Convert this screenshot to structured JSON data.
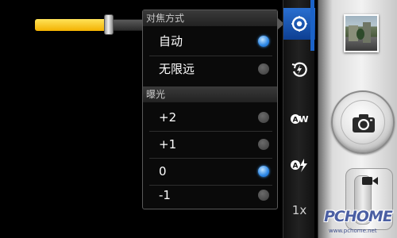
{
  "zoom_slider": {
    "value": 0.68
  },
  "settings_popup": {
    "focus_header": "对焦方式",
    "focus_options": [
      {
        "label": "自动",
        "selected": true
      },
      {
        "label": "无限远",
        "selected": false
      }
    ],
    "exposure_header": "曝光",
    "exposure_options": [
      {
        "label": "+2",
        "selected": false
      },
      {
        "label": "+1",
        "selected": false
      },
      {
        "label": "0",
        "selected": true
      },
      {
        "label": "-1",
        "selected": false
      }
    ]
  },
  "icon_strip": {
    "items": [
      {
        "icon": "focus-icon",
        "active": true
      },
      {
        "icon": "flash-rotate-icon",
        "active": false
      },
      {
        "icon": "auto-white-balance-icon",
        "active": false
      },
      {
        "icon": "auto-flash-icon",
        "active": false
      }
    ],
    "zoom_label": "1x"
  },
  "controls": {
    "thumbnail_icon": "last-photo-thumbnail",
    "shutter_icon": "camera-icon",
    "mode_icon": "video-camera-icon"
  },
  "watermark": {
    "text": "PCHOME",
    "url": "www.pchome.net"
  },
  "colors": {
    "accent_blue": "#2b86e5",
    "slider_yellow": "#f3b100",
    "popup_bg": "#0a0a0a"
  }
}
